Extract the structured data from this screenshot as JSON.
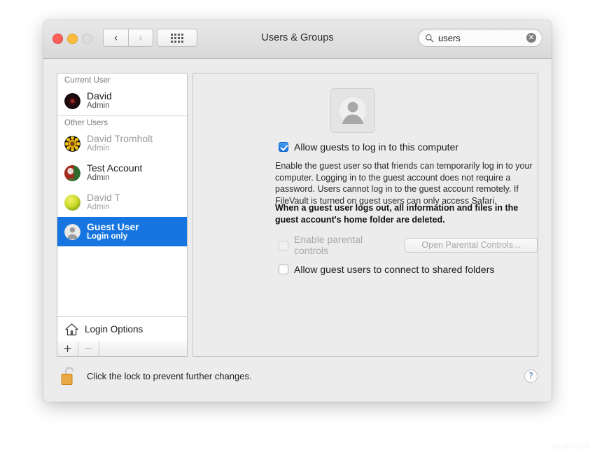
{
  "window": {
    "title": "Users & Groups",
    "traffic_lights": {
      "close": "close",
      "minimize": "minimize",
      "maximize": "maximize"
    },
    "nav": {
      "back": "‹",
      "forward": "›"
    },
    "show_all": "show-all"
  },
  "search": {
    "value": "users",
    "placeholder": "Search",
    "clear": "✕"
  },
  "sidebar": {
    "groups": [
      {
        "header": "Current User",
        "users": [
          {
            "name": "David",
            "role": "Admin",
            "avatar": "dark-red-orb",
            "selected": false,
            "dim": false
          }
        ]
      },
      {
        "header": "Other Users",
        "users": [
          {
            "name": "David Tromholt",
            "role": "Admin",
            "avatar": "sunflower",
            "selected": false,
            "dim": true
          },
          {
            "name": "Test Account",
            "role": "Admin",
            "avatar": "red-green-photo",
            "selected": false,
            "dim": false
          },
          {
            "name": "David T",
            "role": "Admin",
            "avatar": "tennis-ball",
            "selected": false,
            "dim": true
          },
          {
            "name": "Guest User",
            "role": "Login only",
            "avatar": "generic-person",
            "selected": true,
            "dim": false
          }
        ]
      }
    ],
    "login_options": "Login Options",
    "add_button": "+",
    "remove_button": "−"
  },
  "main": {
    "avatar": "generic-person-avatar",
    "allow_guests": {
      "label": "Allow guests to log in to this computer",
      "checked": true
    },
    "description": "Enable the guest user so that friends can temporarily log in to your computer. Logging in to the guest account does not require a password. Users cannot log in to the guest account remotely. If FileVault is turned on guest users can only access Safari.",
    "warning": "When a guest user logs out, all information and files in the guest account's home folder are deleted.",
    "parental_controls": {
      "label": "Enable parental controls",
      "checked": false,
      "disabled": true,
      "button_label": "Open Parental Controls..."
    },
    "shared_folders": {
      "label": "Allow guest users to connect to shared folders",
      "checked": false
    }
  },
  "footer": {
    "lock_icon": "unlocked-padlock",
    "lock_text": "Click the lock to prevent further changes.",
    "help": "?"
  },
  "watermark": "wsxdn.com",
  "colors": {
    "accent_blue": "#1675e0",
    "lock_orange": "#f0a030",
    "window_bg": "#ececec",
    "sidebar_bg": "#ffffff"
  }
}
